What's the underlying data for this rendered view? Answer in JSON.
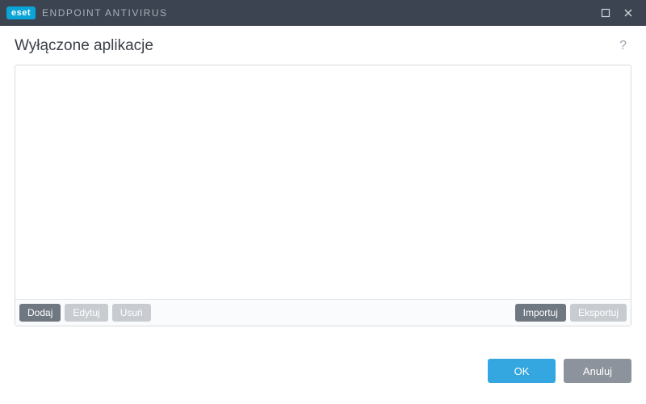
{
  "titlebar": {
    "brand_badge": "eset",
    "product_name": "ENDPOINT ANTIVIRUS"
  },
  "header": {
    "title": "Wyłączone aplikacje",
    "help_icon": "?"
  },
  "list": {
    "items": []
  },
  "toolbar": {
    "add_label": "Dodaj",
    "edit_label": "Edytuj",
    "delete_label": "Usuń",
    "import_label": "Importuj",
    "export_label": "Eksportuj"
  },
  "footer": {
    "ok_label": "OK",
    "cancel_label": "Anuluj"
  }
}
